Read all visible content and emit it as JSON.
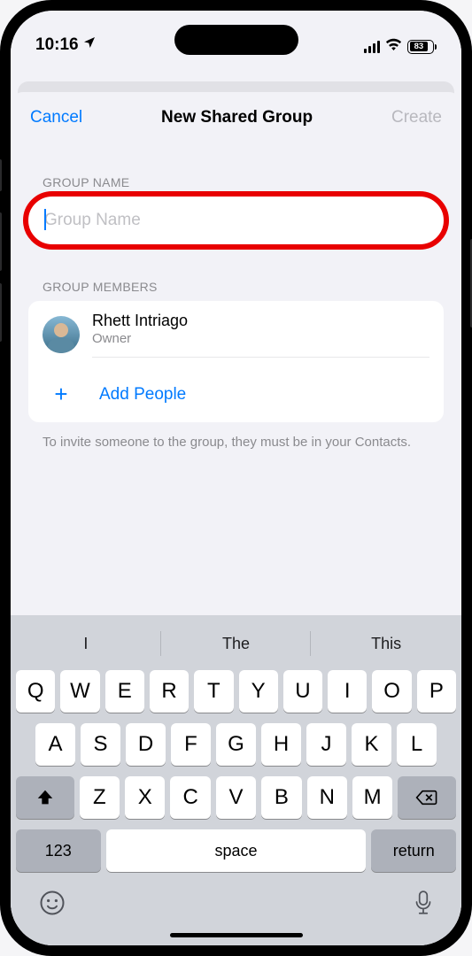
{
  "status": {
    "time": "10:16",
    "battery_pct": "83"
  },
  "nav": {
    "cancel": "Cancel",
    "title": "New Shared Group",
    "create": "Create"
  },
  "sections": {
    "group_name_label": "GROUP NAME",
    "group_name_placeholder": "Group Name",
    "members_label": "GROUP MEMBERS",
    "hint": "To invite someone to the group, they must be in your Contacts."
  },
  "member": {
    "name": "Rhett Intriago",
    "role": "Owner"
  },
  "add_people": "Add People",
  "keyboard": {
    "suggestions": [
      "I",
      "The",
      "This"
    ],
    "row1": [
      "Q",
      "W",
      "E",
      "R",
      "T",
      "Y",
      "U",
      "I",
      "O",
      "P"
    ],
    "row2": [
      "A",
      "S",
      "D",
      "F",
      "G",
      "H",
      "J",
      "K",
      "L"
    ],
    "row3": [
      "Z",
      "X",
      "C",
      "V",
      "B",
      "N",
      "M"
    ],
    "numbers": "123",
    "space": "space",
    "return": "return"
  }
}
